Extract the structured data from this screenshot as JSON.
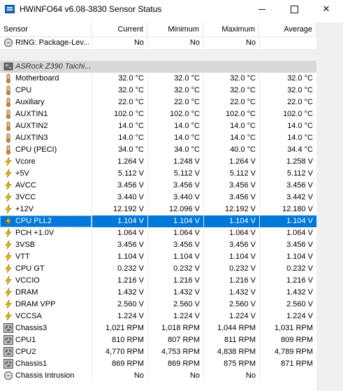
{
  "window": {
    "title": "HWiNFO64 v6.08-3830 Sensor Status"
  },
  "columns": [
    "Sensor",
    "Current",
    "Minimum",
    "Maximum",
    "Average"
  ],
  "rows": [
    {
      "type": "item",
      "icon": "ring-icon",
      "name": "RING: Package-Lev...",
      "values": [
        "No",
        "No",
        "No",
        ""
      ]
    },
    {
      "type": "spacer"
    },
    {
      "type": "group",
      "icon": "motherboard-icon",
      "name": "ASRock Z390 Taichi..."
    },
    {
      "type": "item",
      "icon": "thermometer-icon",
      "name": "Motherboard",
      "values": [
        "32.0 °C",
        "32.0 °C",
        "32.0 °C",
        "32.0 °C"
      ]
    },
    {
      "type": "item",
      "icon": "thermometer-icon",
      "name": "CPU",
      "values": [
        "32.0 °C",
        "32.0 °C",
        "32.0 °C",
        "32.0 °C"
      ]
    },
    {
      "type": "item",
      "icon": "thermometer-icon",
      "name": "Auxiliary",
      "values": [
        "22.0 °C",
        "22.0 °C",
        "22.0 °C",
        "22.0 °C"
      ]
    },
    {
      "type": "item",
      "icon": "thermometer-icon",
      "name": "AUXTIN1",
      "values": [
        "102.0 °C",
        "102.0 °C",
        "102.0 °C",
        "102.0 °C"
      ]
    },
    {
      "type": "item",
      "icon": "thermometer-icon",
      "name": "AUXTIN2",
      "values": [
        "14.0 °C",
        "14.0 °C",
        "14.0 °C",
        "14.0 °C"
      ]
    },
    {
      "type": "item",
      "icon": "thermometer-icon",
      "name": "AUXTIN3",
      "values": [
        "14.0 °C",
        "14.0 °C",
        "14.0 °C",
        "14.0 °C"
      ]
    },
    {
      "type": "item",
      "icon": "thermometer-icon",
      "name": "CPU (PECI)",
      "values": [
        "34.0 °C",
        "34.0 °C",
        "40.0 °C",
        "34.4 °C"
      ]
    },
    {
      "type": "item",
      "icon": "voltage-icon",
      "name": "Vcore",
      "values": [
        "1.264 V",
        "1.248 V",
        "1.264 V",
        "1.258 V"
      ]
    },
    {
      "type": "item",
      "icon": "voltage-icon",
      "name": "+5V",
      "values": [
        "5.112 V",
        "5.112 V",
        "5.112 V",
        "5.112 V"
      ]
    },
    {
      "type": "item",
      "icon": "voltage-icon",
      "name": "AVCC",
      "values": [
        "3.456 V",
        "3.456 V",
        "3.456 V",
        "3.456 V"
      ]
    },
    {
      "type": "item",
      "icon": "voltage-icon",
      "name": "3VCC",
      "values": [
        "3.440 V",
        "3.440 V",
        "3.456 V",
        "3.442 V"
      ]
    },
    {
      "type": "item",
      "icon": "voltage-icon",
      "name": "+12V",
      "values": [
        "12.192 V",
        "12.096 V",
        "12.192 V",
        "12.180 V"
      ]
    },
    {
      "type": "item",
      "icon": "voltage-icon",
      "name": "CPU PLL2",
      "values": [
        "1.104 V",
        "1.104 V",
        "1.104 V",
        "1.104 V"
      ],
      "selected": true
    },
    {
      "type": "item",
      "icon": "voltage-icon",
      "name": "PCH +1.0V",
      "values": [
        "1.064 V",
        "1.064 V",
        "1.064 V",
        "1.064 V"
      ]
    },
    {
      "type": "item",
      "icon": "voltage-icon",
      "name": "3VSB",
      "values": [
        "3.456 V",
        "3.456 V",
        "3.456 V",
        "3.456 V"
      ]
    },
    {
      "type": "item",
      "icon": "voltage-icon",
      "name": "VTT",
      "values": [
        "1.104 V",
        "1.104 V",
        "1.104 V",
        "1.104 V"
      ]
    },
    {
      "type": "item",
      "icon": "voltage-icon",
      "name": "CPU GT",
      "values": [
        "0.232 V",
        "0.232 V",
        "0.232 V",
        "0.232 V"
      ]
    },
    {
      "type": "item",
      "icon": "voltage-icon",
      "name": "VCCIO",
      "values": [
        "1.216 V",
        "1.216 V",
        "1.216 V",
        "1.216 V"
      ]
    },
    {
      "type": "item",
      "icon": "voltage-icon",
      "name": "DRAM",
      "values": [
        "1.432 V",
        "1.432 V",
        "1.432 V",
        "1.432 V"
      ]
    },
    {
      "type": "item",
      "icon": "voltage-icon",
      "name": "DRAM VPP",
      "values": [
        "2.560 V",
        "2.560 V",
        "2.560 V",
        "2.560 V"
      ]
    },
    {
      "type": "item",
      "icon": "voltage-icon",
      "name": "VCCSA",
      "values": [
        "1.224 V",
        "1.224 V",
        "1.224 V",
        "1.224 V"
      ]
    },
    {
      "type": "item",
      "icon": "fan-icon",
      "name": "Chassis3",
      "values": [
        "1,021 RPM",
        "1,018 RPM",
        "1,044 RPM",
        "1,031 RPM"
      ]
    },
    {
      "type": "item",
      "icon": "fan-icon",
      "name": "CPU1",
      "values": [
        "810 RPM",
        "807 RPM",
        "811 RPM",
        "809 RPM"
      ]
    },
    {
      "type": "item",
      "icon": "fan-icon",
      "name": "CPU2",
      "values": [
        "4,770 RPM",
        "4,753 RPM",
        "4,838 RPM",
        "4,789 RPM"
      ]
    },
    {
      "type": "item",
      "icon": "fan-icon",
      "name": "Chassis1",
      "values": [
        "869 RPM",
        "869 RPM",
        "875 RPM",
        "871 RPM"
      ]
    },
    {
      "type": "item",
      "icon": "ring-icon",
      "name": "Chassis Intrusion",
      "values": [
        "No",
        "No",
        "No",
        ""
      ]
    }
  ],
  "colors": {
    "selection": "#0078d7",
    "group_bg": "#d8d8d8",
    "thermometer": "#d08a2a",
    "voltage": "#f0c000"
  }
}
